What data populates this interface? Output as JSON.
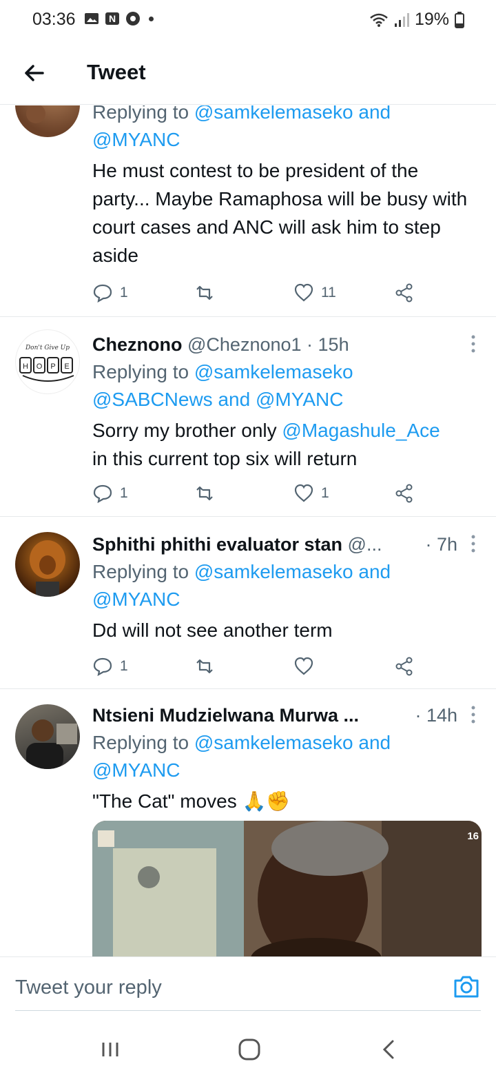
{
  "status_bar": {
    "time": "03:36",
    "battery": "19%",
    "icons": [
      "gallery-icon",
      "n-icon",
      "chrome-icon",
      "dot-icon",
      "wifi-icon",
      "signal-icon",
      "battery-icon"
    ]
  },
  "header": {
    "title": "Tweet",
    "back_icon": "arrow-left-icon"
  },
  "tweets": [
    {
      "reply_prefix": "Replying to",
      "reply_mentions_line1": "@samkelemaseko",
      "reply_and": "and",
      "reply_mentions_line2": "@MYANC",
      "text": "He must contest to be president of the party... Maybe Ramaphosa will be busy with court cases and ANC will ask him to step aside",
      "replies": "1",
      "retweets": "",
      "likes": "11"
    },
    {
      "name": "Cheznono",
      "handle": "@Cheznono1",
      "time": "· 15h",
      "reply_prefix": "Replying to",
      "reply_mention_a": "@samkelemaseko",
      "reply_mention_b": "@SABCNews",
      "reply_and": "and",
      "reply_mention_c": "@MYANC",
      "text_before": "Sorry my brother only",
      "text_mention": "@Magashule_Ace",
      "text_after": "in this current top six will return",
      "replies": "1",
      "retweets": "",
      "likes": "1"
    },
    {
      "name": "Sphithi phithi evaluator stan",
      "handle": "@...",
      "time": "· 7h",
      "reply_prefix": "Replying to",
      "reply_mention_a": "@samkelemaseko",
      "reply_and": "and",
      "reply_mention_b": "@MYANC",
      "text": "Dd will not see another term",
      "replies": "1",
      "retweets": "",
      "likes": ""
    },
    {
      "name": "Ntsieni Mudzielwana Murwa ...",
      "time": "· 14h",
      "reply_prefix": "Replying to",
      "reply_mention_a": "@samkelemaseko",
      "reply_and": "and",
      "reply_mention_b": "@MYANC",
      "text": "\"The Cat\" moves",
      "emoji": "🙏✊",
      "media_badge": "16"
    }
  ],
  "reply_bar": {
    "placeholder": "Tweet your reply"
  },
  "colors": {
    "accent": "#1d9bf0",
    "text": "#0f1419",
    "muted": "#536471",
    "divider": "#e6e9eb"
  }
}
